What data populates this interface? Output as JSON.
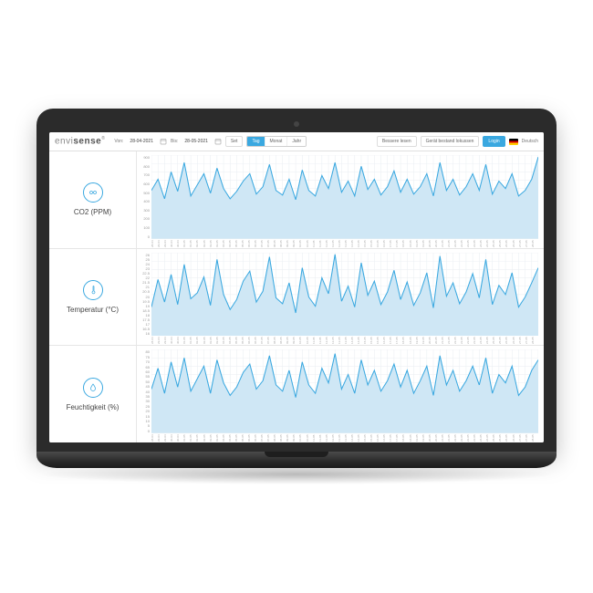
{
  "brand": {
    "light": "envi",
    "bold": "sense",
    "reg": "®"
  },
  "toolbar": {
    "from_label": "Von:",
    "from_value": "28-04-2021",
    "to_label": "Bis:",
    "to_value": "28-05-2021",
    "set_label": "Set",
    "seg": {
      "tag": "Tag",
      "monat": "Monat",
      "jahr": "Jahr"
    },
    "replace": "Bessere lesen",
    "existing": "Gerät bestand lokussen",
    "login": "Login",
    "lang": "Deutsch"
  },
  "metrics": {
    "co2": "CO2 (PPM)",
    "temp": "Temperatur (°C)",
    "hum": "Feuchtigkeit (%)"
  },
  "chart_data": [
    {
      "type": "area",
      "title": "CO2 (PPM)",
      "ylabel": "PPM",
      "xlabel": "",
      "ylim": [
        0,
        900
      ],
      "yticks": [
        900,
        800,
        700,
        600,
        500,
        400,
        300,
        200,
        100,
        0
      ],
      "categories": [
        "28-04",
        "29-04",
        "29-04",
        "30-04",
        "30-04",
        "01-05",
        "01-05",
        "02-05",
        "02-05",
        "03-05",
        "03-05",
        "04-05",
        "04-05",
        "05-05",
        "05-05",
        "06-05",
        "06-05",
        "07-05",
        "07-05",
        "08-05",
        "08-05",
        "09-05",
        "09-05",
        "10-05",
        "10-05",
        "11-05",
        "11-05",
        "12-05",
        "12-05",
        "13-05",
        "13-05",
        "14-05",
        "14-05",
        "15-05",
        "15-05",
        "16-05",
        "16-05",
        "17-05",
        "17-05",
        "18-05",
        "18-05",
        "19-05",
        "19-05",
        "20-05",
        "20-05",
        "21-05",
        "21-05",
        "22-05",
        "22-05",
        "23-05",
        "23-05",
        "24-05",
        "24-05",
        "25-05",
        "25-05",
        "26-05",
        "26-05",
        "27-05",
        "27-05",
        "28-05"
      ],
      "values": [
        520,
        640,
        430,
        720,
        510,
        820,
        460,
        580,
        700,
        490,
        760,
        540,
        430,
        510,
        620,
        700,
        480,
        560,
        800,
        520,
        470,
        640,
        420,
        740,
        520,
        460,
        680,
        540,
        820,
        500,
        620,
        460,
        780,
        530,
        640,
        470,
        560,
        730,
        500,
        640,
        480,
        560,
        700,
        460,
        820,
        520,
        640,
        470,
        560,
        700,
        520,
        800,
        480,
        620,
        540,
        700,
        460,
        520,
        640,
        880
      ]
    },
    {
      "type": "area",
      "title": "Temperatur (°C)",
      "ylabel": "°C",
      "xlabel": "",
      "ylim": [
        16,
        26
      ],
      "yticks": [
        26,
        25,
        24,
        23,
        22.5,
        22,
        21.5,
        21,
        20.5,
        20,
        19.5,
        19,
        18.5,
        18,
        17.5,
        17,
        16.5,
        16
      ],
      "categories": [
        "28-04",
        "29-04",
        "29-04",
        "30-04",
        "30-04",
        "01-05",
        "01-05",
        "02-05",
        "02-05",
        "03-05",
        "03-05",
        "04-05",
        "04-05",
        "05-05",
        "05-05",
        "06-05",
        "06-05",
        "07-05",
        "07-05",
        "08-05",
        "08-05",
        "09-05",
        "09-05",
        "10-05",
        "10-05",
        "11-05",
        "11-05",
        "12-05",
        "12-05",
        "13-05",
        "13-05",
        "14-05",
        "14-05",
        "15-05",
        "15-05",
        "16-05",
        "16-05",
        "17-05",
        "17-05",
        "18-05",
        "18-05",
        "19-05",
        "19-05",
        "20-05",
        "20-05",
        "21-05",
        "21-05",
        "22-05",
        "22-05",
        "23-05",
        "23-05",
        "24-05",
        "24-05",
        "25-05",
        "25-05",
        "26-05",
        "26-05",
        "27-05",
        "27-05",
        "28-05"
      ],
      "values": [
        19.5,
        22.8,
        20.1,
        23.4,
        19.8,
        24.6,
        20.5,
        21.2,
        23.1,
        19.7,
        25.2,
        21.0,
        19.2,
        20.4,
        22.6,
        23.8,
        20.1,
        21.4,
        25.5,
        20.6,
        19.9,
        22.4,
        18.8,
        24.2,
        20.7,
        19.6,
        23.0,
        21.1,
        25.8,
        20.2,
        22.0,
        19.5,
        24.8,
        20.9,
        22.6,
        19.8,
        21.3,
        23.9,
        20.4,
        22.5,
        19.7,
        21.2,
        23.6,
        19.4,
        25.6,
        20.8,
        22.4,
        19.9,
        21.3,
        23.5,
        20.6,
        25.2,
        19.8,
        22.1,
        21.0,
        23.6,
        19.5,
        20.7,
        22.4,
        24.2
      ]
    },
    {
      "type": "area",
      "title": "Feuchtigkeit (%)",
      "ylabel": "%",
      "xlabel": "",
      "ylim": [
        0,
        80
      ],
      "yticks": [
        80,
        75,
        70,
        65,
        60,
        55,
        50,
        45,
        40,
        35,
        30,
        25,
        20,
        15,
        10,
        5,
        0
      ],
      "categories": [
        "28-04",
        "29-04",
        "29-04",
        "30-04",
        "30-04",
        "01-05",
        "01-05",
        "02-05",
        "02-05",
        "03-05",
        "03-05",
        "04-05",
        "04-05",
        "05-05",
        "05-05",
        "06-05",
        "06-05",
        "07-05",
        "07-05",
        "08-05",
        "08-05",
        "09-05",
        "09-05",
        "10-05",
        "10-05",
        "11-05",
        "11-05",
        "12-05",
        "12-05",
        "13-05",
        "13-05",
        "14-05",
        "14-05",
        "15-05",
        "15-05",
        "16-05",
        "16-05",
        "17-05",
        "17-05",
        "18-05",
        "18-05",
        "19-05",
        "19-05",
        "20-05",
        "20-05",
        "21-05",
        "21-05",
        "22-05",
        "22-05",
        "23-05",
        "23-05",
        "24-05",
        "24-05",
        "25-05",
        "25-05",
        "26-05",
        "26-05",
        "27-05",
        "27-05",
        "28-05"
      ],
      "values": [
        42,
        62,
        38,
        68,
        44,
        72,
        40,
        52,
        64,
        38,
        70,
        48,
        36,
        44,
        58,
        66,
        42,
        50,
        74,
        46,
        40,
        60,
        34,
        68,
        46,
        38,
        62,
        48,
        76,
        42,
        56,
        38,
        70,
        46,
        60,
        40,
        50,
        66,
        44,
        60,
        38,
        50,
        64,
        36,
        74,
        46,
        60,
        40,
        50,
        64,
        46,
        72,
        38,
        56,
        48,
        64,
        36,
        44,
        60,
        70
      ]
    }
  ]
}
